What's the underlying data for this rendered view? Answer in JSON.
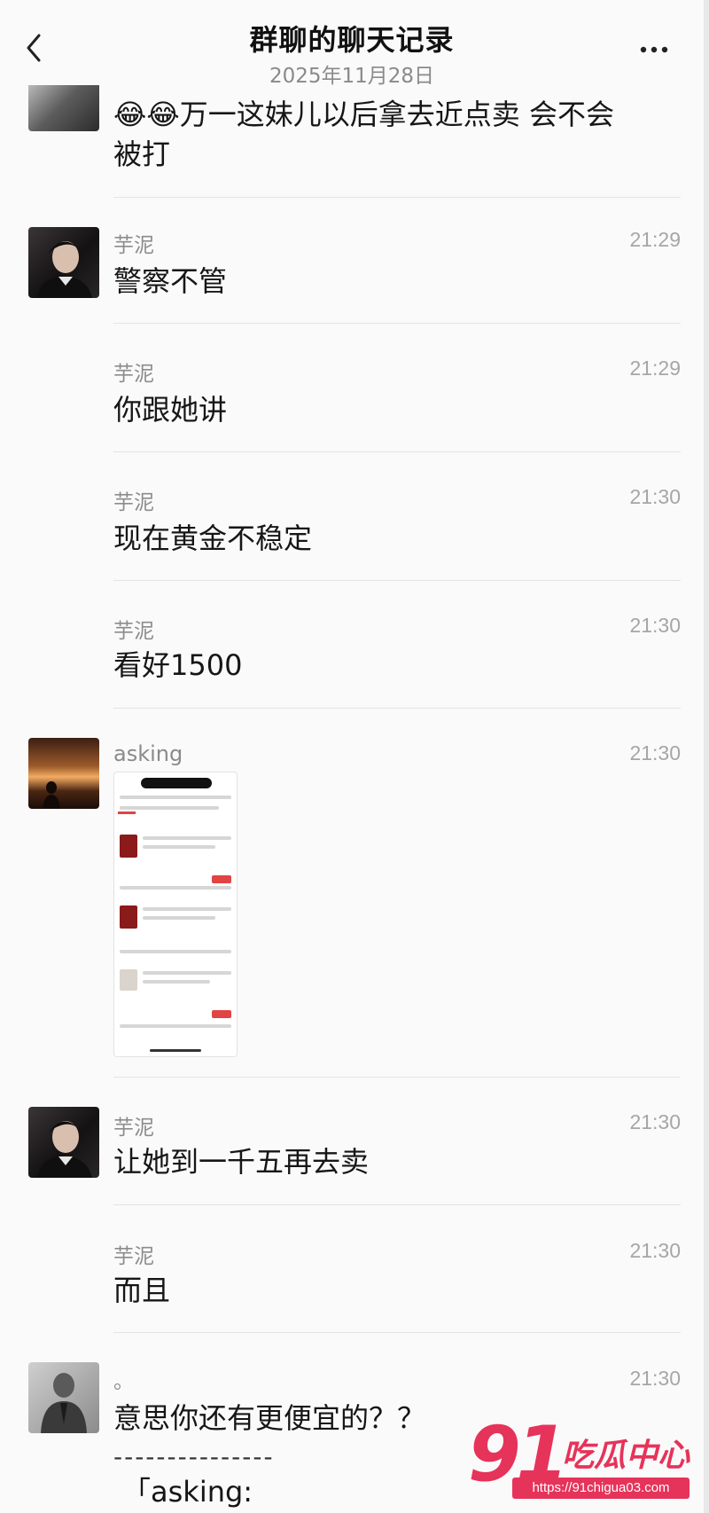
{
  "header": {
    "title": "群聊的聊天记录",
    "date": "2025年11月28日"
  },
  "messages": [
    {
      "sender": "",
      "time": "",
      "text": "😂😂万一这妹儿以后拿去近点卖  会不会",
      "text2": "被打"
    },
    {
      "sender": "芋泥",
      "time": "21:29",
      "text": "警察不管"
    },
    {
      "sender": "芋泥",
      "time": "21:29",
      "text": "你跟她讲"
    },
    {
      "sender": "芋泥",
      "time": "21:30",
      "text": "现在黄金不稳定"
    },
    {
      "sender": "芋泥",
      "time": "21:30",
      "text": "看好1500"
    },
    {
      "sender": "asking",
      "time": "21:30",
      "text": ""
    },
    {
      "sender": "芋泥",
      "time": "21:30",
      "text": "让她到一千五再去卖"
    },
    {
      "sender": "芋泥",
      "time": "21:30",
      "text": "而且"
    },
    {
      "sender": "。",
      "time": "21:30",
      "text": "意思你还有更便宜的？？",
      "text2": "---------------",
      "text3": "「asking:"
    }
  ],
  "watermark": {
    "number": "91",
    "text": "吃瓜中心",
    "url": "https://91chigua03.com"
  }
}
